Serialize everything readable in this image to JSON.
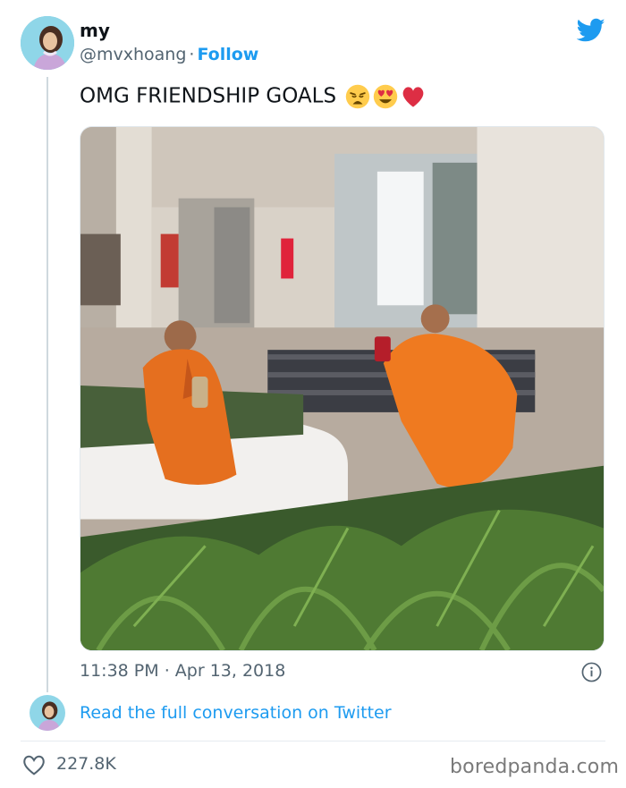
{
  "author": {
    "display_name": "my",
    "handle": "@mvxhoang",
    "separator": "·",
    "follow_label": "Follow",
    "avatar_icon": "profile-photo"
  },
  "brand": {
    "logo_icon": "twitter-bird-icon",
    "accent": "#1d9bf0"
  },
  "tweet": {
    "text": "OMG FRIENDSHIP GOALS",
    "emojis": [
      "weary-face-icon",
      "heart-eyes-icon",
      "red-heart-icon"
    ],
    "photo_description_icon": "photo",
    "time": "11:38 PM",
    "date": "Apr 13, 2018",
    "separator": "·"
  },
  "conversation": {
    "link_label": "Read the full conversation on Twitter"
  },
  "engagement": {
    "likes": "227.8K",
    "like_icon": "heart-outline-icon"
  },
  "watermark": {
    "text": "boredpanda.com"
  }
}
